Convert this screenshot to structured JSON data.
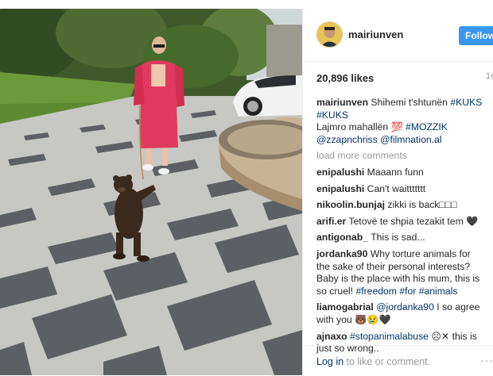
{
  "post": {
    "username": "mairiunven",
    "follow_label": "Follow",
    "likes": "20,896 likes",
    "time_fragment": "1c",
    "caption": {
      "username": "mairiunven",
      "line1": "Shihemi t'shtunën ",
      "tag1": "#KUKS",
      "tag2": "#KUKS",
      "line2": "Lajmro mahallën 💯 ",
      "tag3": "#MOZZIK",
      "mention1": "@zzapnchriss",
      "mention2": "@filmnation.al"
    },
    "load_more": "load more comments",
    "comments": [
      {
        "user": "enipalushi",
        "text": "Maaann funn"
      },
      {
        "user": "enipalushi",
        "text": "Can't waittttttt"
      },
      {
        "user": "nikoolin.bunjaj",
        "text": "zikki is back□□□"
      },
      {
        "user": "arifi.er",
        "text": "Tetovë te shpia tezakit tem 🖤"
      },
      {
        "user": "antigonab_",
        "text": "This is sad..."
      },
      {
        "user": "jordanka90",
        "text": "Why torture animals for the sake of their personal interests? Baby is the place with his mum, this is so cruel! ",
        "tags": "#freedom #for #animals"
      },
      {
        "user": "liamogabrial",
        "mention": "@jordanka90",
        "text": " I so agree with you 🐻😢🖤"
      },
      {
        "user": "ajnaxo",
        "tag": "#stopanimalabuse",
        "text": " ☹✕ this is just so wrong.."
      }
    ],
    "footer": {
      "login_link": "Log in",
      "login_rest": " to like or comment.",
      "more": "···"
    }
  },
  "colors": {
    "accent": "#3897f0",
    "link": "#003569",
    "muted": "#999999"
  }
}
